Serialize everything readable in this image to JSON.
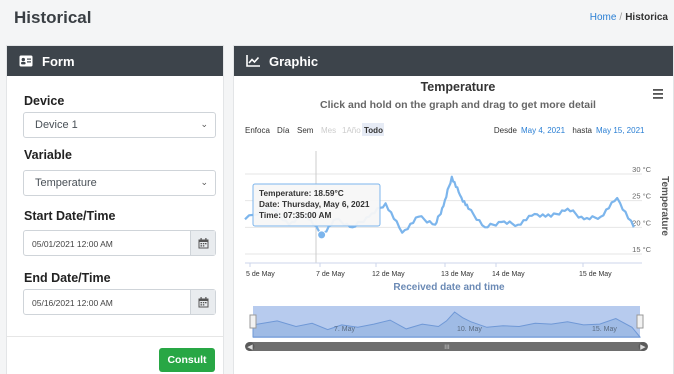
{
  "header": {
    "title": "Historical",
    "breadcrumb_home": "Home",
    "breadcrumb_sep": "/",
    "breadcrumb_current": "Historica"
  },
  "form": {
    "title": "Form",
    "device_label": "Device",
    "device_value": "Device 1",
    "variable_label": "Variable",
    "variable_value": "Temperature",
    "start_label": "Start Date/Time",
    "start_value": "05/01/2021 12:00 AM",
    "end_label": "End Date/Time",
    "end_value": "05/16/2021 12:00 AM",
    "consult_label": "Consult"
  },
  "graphic": {
    "title": "Graphic",
    "menu_icon": "hamburger-icon",
    "zoom_label": "Enfoca",
    "range_buttons": [
      {
        "label": "Día",
        "state": "normal"
      },
      {
        "label": "Sem",
        "state": "normal"
      },
      {
        "label": "Mes",
        "state": "disabled"
      },
      {
        "label": "1Año",
        "state": "disabled"
      },
      {
        "label": "Todo",
        "state": "selected"
      }
    ],
    "from_label": "Desde",
    "from_value": "May 4, 2021",
    "to_label": "hasta",
    "to_value": "May 15, 2021",
    "tooltip": {
      "line1": "Temperature: 18.59°C",
      "line2": "Date: Thursday, May 6, 2021",
      "line3": "Time: 07:35:00 AM"
    },
    "navigator_labels": [
      "7. May",
      "10. May",
      "15. May"
    ],
    "navigator_grip": "III"
  },
  "colors": {
    "line": "#7cb5ec",
    "header_bg": "#3d444b",
    "button_green": "#28a745",
    "link_blue": "#2a7fd4"
  },
  "chart_data": {
    "type": "line",
    "title": "Temperature",
    "subtitle": "Click and hold on the graph and drag to get more detail",
    "xlabel": "Received date and time",
    "ylabel": "Temperature",
    "x_ticks": [
      "5 de May",
      "7 de May",
      "12 de May",
      "13 de May",
      "14 de May",
      "15 de May"
    ],
    "y_ticks": [
      "30 °C",
      "25 °C",
      "20 °C",
      "15 °C"
    ],
    "ylim": [
      15,
      30
    ],
    "series": [
      {
        "x": [
          "2021-05-04 00:00",
          "2021-05-04 18:00",
          "2021-05-05 08:00",
          "2021-05-05 20:00",
          "2021-05-06 07:35",
          "2021-05-06 18:00",
          "2021-05-07 06:00",
          "2021-05-07 18:00",
          "2021-05-08 06:00",
          "2021-05-08 18:00",
          "2021-05-09 06:00",
          "2021-05-09 18:00",
          "2021-05-10 00:00",
          "2021-05-10 06:00",
          "2021-05-10 12:00",
          "2021-05-10 18:00",
          "2021-05-11 06:00",
          "2021-05-11 18:00",
          "2021-05-12 06:00",
          "2021-05-12 18:00",
          "2021-05-13 06:00",
          "2021-05-13 18:00",
          "2021-05-14 06:00",
          "2021-05-14 18:00",
          "2021-05-15 06:00",
          "2021-05-15 18:00"
        ],
        "values": [
          21.5,
          24,
          20.5,
          22.5,
          18.59,
          21.5,
          20,
          22,
          24.5,
          19,
          22,
          20.5,
          24,
          29.5,
          26,
          23.5,
          20,
          21,
          20.5,
          22.5,
          22,
          23.5,
          21.5,
          22,
          25.5,
          20
        ]
      }
    ]
  }
}
